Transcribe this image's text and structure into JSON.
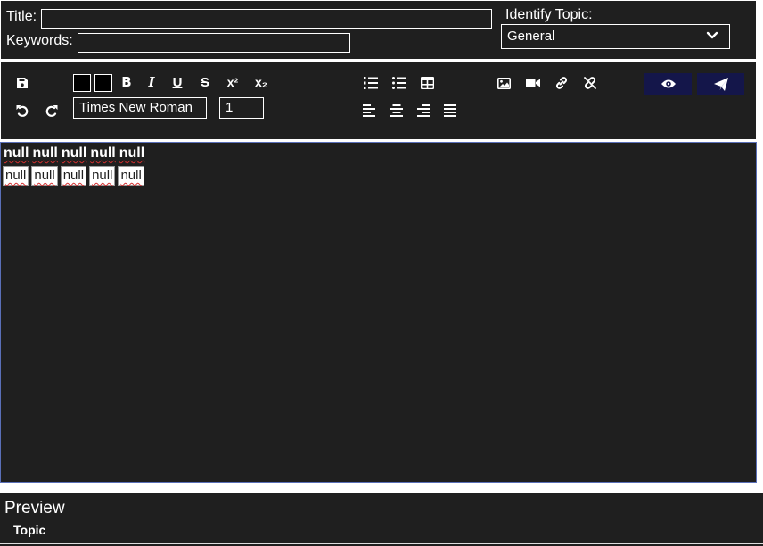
{
  "form": {
    "title_label": "Title:",
    "title_value": "",
    "keywords_label": "Keywords:",
    "keywords_value": "",
    "topic_label": "Identify Topic:",
    "topic_selected": "General"
  },
  "toolbar": {
    "bold": "B",
    "italic": "I",
    "underline": "U",
    "strike": "S",
    "superscript": "x²",
    "subscript": "x₂",
    "font_family": "Times New Roman",
    "font_size": "1",
    "text_color": "#000000",
    "highlight_color": "#000000"
  },
  "editor": {
    "header_cells": [
      "null",
      "null",
      "null",
      "null",
      "null"
    ],
    "row_cells": [
      "null",
      "null",
      "null",
      "null",
      "null"
    ]
  },
  "preview": {
    "title": "Preview",
    "topic": "Topic"
  },
  "colors": {
    "panel_bg": "#1f1f1f",
    "action_button_bg": "#14164a",
    "editor_border": "#5a6fb8"
  },
  "icons": {
    "save": "save-icon",
    "undo": "undo-icon",
    "redo": "redo-icon",
    "ordered_list": "ordered-list-icon",
    "unordered_list": "unordered-list-icon",
    "table": "table-icon",
    "image": "image-icon",
    "video": "video-icon",
    "link": "link-icon",
    "unlink": "unlink-icon",
    "preview": "eye-icon",
    "publish": "paper-plane-icon"
  }
}
